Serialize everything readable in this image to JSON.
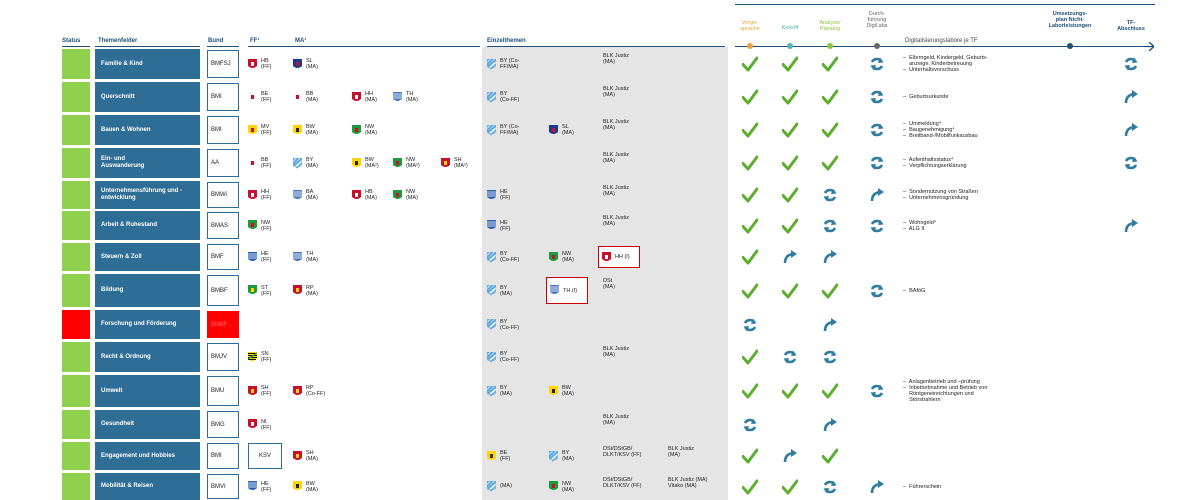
{
  "title": "",
  "columns": {
    "status": "Status",
    "topic": "Themenfelder",
    "bund": "Bund",
    "ff": "FF¹",
    "ma": "MA¹",
    "einzel": "Einzelthemen",
    "labs": "Digitalisierungslabore je TF"
  },
  "phases": [
    {
      "label": "Vorge-\nspräche",
      "color": "#e8a33d"
    },
    {
      "label": "Kickoff",
      "color": "#53b1b5"
    },
    {
      "label": "Analyse/\nPlanung",
      "color": "#8bc43f"
    },
    {
      "label": "Durch-\nführung\nDigil.abs",
      "color": "#666666"
    },
    {
      "label": "Umsetzungs-\nplan Nicht-\nLaborleistungen",
      "color": "#1e4e79"
    },
    {
      "label": "TF-\nAbschluss",
      "color": "#1e4e79"
    }
  ],
  "colors": {
    "green": "#8fd14f",
    "red": "#ff0000",
    "topic": "#2e6e96",
    "check": "#5bae2e",
    "progress": "#2e7c9e"
  },
  "rows": [
    {
      "status": "green",
      "topic": "Familie & Kind",
      "bund": "BMFSJ",
      "bund_red": false,
      "ff": [
        {
          "t": "HB\n(FF)",
          "c": "hb"
        }
      ],
      "ma": [
        {
          "t": "SL\n(MA)",
          "c": "sl"
        }
      ],
      "einzel": [
        {
          "t": "BY (Co-\nFF/MA)",
          "c": "by"
        }
      ],
      "single": "BLK Justiz\n(MA)",
      "single2": "",
      "hl": null,
      "phases": [
        "check",
        "check",
        "check",
        "cycle",
        "",
        "cycle"
      ],
      "notes": [
        "–  Elterngeld, Kindergeld, Geburts-",
        "    anzeige, Kinderbetreuung",
        "–  Unterhaltsvorschuss"
      ]
    },
    {
      "status": "green",
      "topic": "Querschnitt",
      "bund": "BMI",
      "bund_red": false,
      "ff": [
        {
          "t": "BE\n(FF)",
          "c": "be"
        }
      ],
      "ma": [
        {
          "t": "BB\n(MA)",
          "c": "bb"
        },
        {
          "t": "HH\n(MA)",
          "c": "hh"
        },
        {
          "t": "TH\n(MA)",
          "c": "th"
        }
      ],
      "einzel": [
        {
          "t": "BY\n(Co-FF)",
          "c": "by"
        }
      ],
      "single": "BLK Justiz\n(MA)",
      "single2": "",
      "hl": null,
      "phases": [
        "check",
        "check",
        "check",
        "cycle",
        "",
        "arrow"
      ],
      "notes": [
        "–  Geburtsurkunde"
      ]
    },
    {
      "status": "green",
      "topic": "Bauen & Wohnen",
      "bund": "BMI",
      "bund_red": false,
      "ff": [
        {
          "t": "MV\n(FF)",
          "c": "mv"
        }
      ],
      "ma": [
        {
          "t": "BW\n(MA)",
          "c": "bw"
        },
        {
          "t": "NW\n(MA)",
          "c": "nw"
        }
      ],
      "einzel": [
        {
          "t": "BY (Co-\nFF/MA)",
          "c": "by"
        },
        {
          "t": "SL\n(MA)",
          "c": "sl"
        }
      ],
      "single": "BLK Justiz\n(MA)",
      "single2": "",
      "hl": null,
      "phases": [
        "check",
        "check",
        "check",
        "cycle",
        "",
        "arrow"
      ],
      "notes": [
        "–  Ummeldung⁴",
        "–  Baugenehmigung⁴",
        "–  Breitband-/Mobilfunkausbau"
      ]
    },
    {
      "status": "green",
      "topic": "Ein- und\nAuswanderung",
      "bund": "AA",
      "bund_red": false,
      "ff": [
        {
          "t": "BB\n(FF)",
          "c": "bb"
        }
      ],
      "ma": [
        {
          "t": "BY\n(MA)",
          "c": "by"
        },
        {
          "t": "BW\n(MA²)",
          "c": "bw"
        },
        {
          "t": "NW\n(MA²)",
          "c": "nw"
        },
        {
          "t": "SH\n(MA²)",
          "c": "sh"
        }
      ],
      "einzel": [],
      "single": "BLK Justiz\n(MA)",
      "single2": "",
      "hl": null,
      "phases": [
        "check",
        "check",
        "check",
        "cycle",
        "",
        "cycle"
      ],
      "notes": [
        "–  Aufenthaltsstatus⁴",
        "–  Verpflichtungserklärung"
      ]
    },
    {
      "status": "green",
      "topic": "Unternehmensführung und -\nentwicklung",
      "bund": "BMWi",
      "bund_red": false,
      "ff": [
        {
          "t": "HH\n(FF)",
          "c": "hh"
        }
      ],
      "ma": [
        {
          "t": "BA\n(MA)",
          "c": "th"
        },
        {
          "t": "HB\n(MA)",
          "c": "hb"
        },
        {
          "t": "NW\n(MA)",
          "c": "nw"
        }
      ],
      "einzel": [
        {
          "t": "HE\n(FF)",
          "c": "he"
        }
      ],
      "single": "BLK Justiz\n(MA)",
      "single2": "",
      "hl": null,
      "phases": [
        "check",
        "check",
        "cycle",
        "arrow",
        "",
        ""
      ],
      "notes": [
        "–  Sondernutzung von Straßen",
        "–  Unternehmensgründung"
      ]
    },
    {
      "status": "green",
      "topic": "Arbeit & Ruhestand",
      "bund": "BMAS",
      "bund_red": false,
      "ff": [
        {
          "t": "NW\n(FF)",
          "c": "nw"
        }
      ],
      "ma": [],
      "einzel": [
        {
          "t": "HE\n(FF)",
          "c": "he"
        }
      ],
      "single": "BLK Justiz\n(MA)",
      "single2": "",
      "hl": null,
      "phases": [
        "check",
        "check",
        "cycle",
        "cycle",
        "",
        "arrow"
      ],
      "notes": [
        "–  Wohngeld⁴",
        "–  ALG II"
      ]
    },
    {
      "status": "green",
      "topic": "Steuern & Zoll",
      "bund": "BMF",
      "bund_red": false,
      "ff": [
        {
          "t": "HE\n(FF)",
          "c": "he"
        }
      ],
      "ma": [
        {
          "t": "TH\n(MA)",
          "c": "th"
        }
      ],
      "einzel": [
        {
          "t": "BY\n(Co-FF)",
          "c": "by"
        },
        {
          "t": "NW\n(MA)",
          "c": "nw"
        }
      ],
      "single": "",
      "single2": "",
      "hl": {
        "t": "HH (I)",
        "c": "hh",
        "pos": "c3"
      },
      "phases": [
        "check",
        "arrow",
        "arrow",
        "",
        "",
        ""
      ],
      "notes": []
    },
    {
      "status": "green",
      "topic": "Bildung",
      "bund": "BMBF",
      "bund_red": false,
      "ff": [
        {
          "t": "ST\n(FF)",
          "c": "st"
        }
      ],
      "ma": [
        {
          "t": "RP\n(MA)",
          "c": "rp"
        }
      ],
      "einzel": [
        {
          "t": "BY\n(MA)",
          "c": "by"
        }
      ],
      "single": "DSt\n(MA)",
      "single2": "",
      "hl": {
        "t": "TH (I)",
        "c": "th",
        "pos": "c2"
      },
      "phases": [
        "check",
        "check",
        "check",
        "cycle",
        "",
        ""
      ],
      "notes": [
        "–  BAföG"
      ]
    },
    {
      "status": "red",
      "topic": "Forschung und Förderung",
      "bund": "BMBF",
      "bund_red": true,
      "ff": [],
      "ma": [],
      "einzel": [
        {
          "t": "BY\n(Co-FF)",
          "c": "by"
        }
      ],
      "single": "",
      "single2": "",
      "hl": null,
      "phases": [
        "cycle",
        "",
        "arrow",
        "",
        "",
        ""
      ],
      "notes": []
    },
    {
      "status": "green",
      "topic": "Recht & Ordnung",
      "bund": "BMJV",
      "bund_red": false,
      "ff": [
        {
          "t": "SN\n(FF)",
          "c": "sn"
        }
      ],
      "ma": [],
      "einzel": [
        {
          "t": "BY\n(Co-FF)",
          "c": "by"
        }
      ],
      "single": "BLK Justiz\n(MA)",
      "single2": "",
      "hl": null,
      "phases": [
        "check",
        "cycle",
        "cycle",
        "",
        "",
        ""
      ],
      "notes": []
    },
    {
      "status": "green",
      "topic": "Umwelt",
      "bund": "BMU",
      "bund_red": false,
      "ff": [
        {
          "t": "SH\n(FF)",
          "c": "sh"
        }
      ],
      "ma": [
        {
          "t": "RP\n(Co-FF)",
          "c": "rp"
        }
      ],
      "einzel": [
        {
          "t": "BY\n(MA)",
          "c": "by"
        },
        {
          "t": "BW\n(MA)",
          "c": "bw"
        }
      ],
      "single": "",
      "single2": "",
      "hl": null,
      "phases": [
        "check",
        "check",
        "check",
        "cycle",
        "",
        ""
      ],
      "notes": [
        "–  Anlagenbetrieb und –prüfung",
        "–  Inbetriebnahme und Betrieb von",
        "    Röntgeneinrichtungen und",
        "    Störstrahlern"
      ]
    },
    {
      "status": "green",
      "topic": "Gesundheit",
      "bund": "BMG",
      "bund_red": false,
      "ff": [
        {
          "t": "NI\n(FF)",
          "c": "ni"
        }
      ],
      "ma": [],
      "einzel": [],
      "single": "BLK Justiz\n(MA)",
      "single2": "",
      "hl": null,
      "phases": [
        "cycle",
        "",
        "arrow",
        "",
        "",
        ""
      ],
      "notes": []
    },
    {
      "status": "green",
      "topic": "Engagement und Hobbies",
      "bund": "BMI",
      "bund_red": false,
      "ksv": "KSV",
      "ff": [],
      "ma": [
        {
          "t": "SH\n(MA)",
          "c": "sh"
        }
      ],
      "einzel": [
        {
          "t": "BE\n(FF)",
          "c": "be2"
        },
        {
          "t": "BY\n(MA)",
          "c": "by"
        }
      ],
      "single": "DSt/DStGB/\nDLKT/KSV (FF)",
      "single2": "BLK Justiz\n(MA)",
      "hl": null,
      "phases": [
        "check",
        "arrow",
        "check",
        "",
        "",
        ""
      ],
      "notes": []
    },
    {
      "status": "green",
      "topic": "Mobilität & Reisen",
      "bund": "BMVI",
      "bund_red": false,
      "ff": [
        {
          "t": "HE\n(FF)",
          "c": "he"
        }
      ],
      "ma": [
        {
          "t": "BW\n(MA)",
          "c": "bw"
        }
      ],
      "einzel": [
        {
          "t": "(MA)",
          "c": "by"
        },
        {
          "t": "NW\n(MA)",
          "c": "nw"
        }
      ],
      "single": "DSt/DStGB/\nDLKT/KSV (FF)",
      "single2": "BLK Justiz (MA)\nVitako (MA)",
      "hl": null,
      "phases": [
        "check",
        "check",
        "cycle",
        "arrow",
        "",
        ""
      ],
      "notes": [
        "–  Führerschein"
      ]
    }
  ]
}
